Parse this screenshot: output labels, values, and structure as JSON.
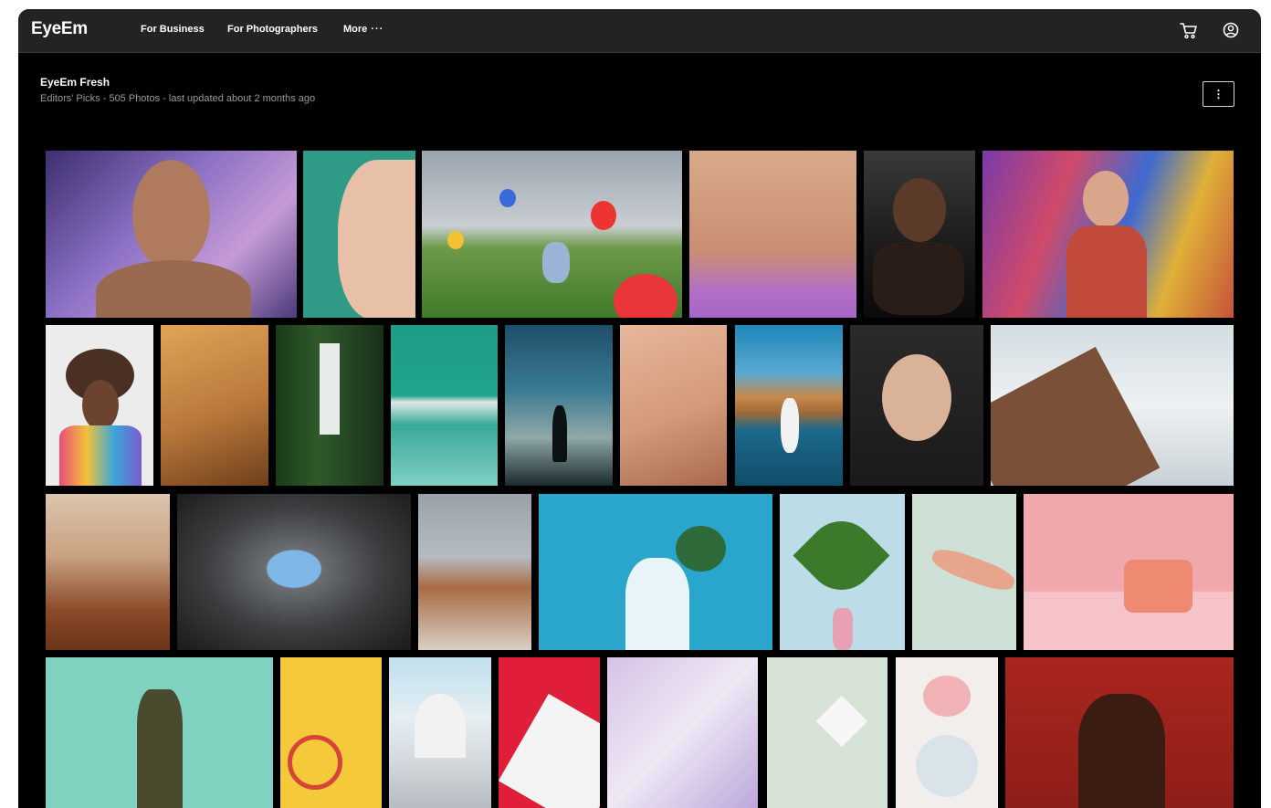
{
  "app": {
    "logo": "EyeEm"
  },
  "nav": {
    "items": [
      {
        "label": "For Business"
      },
      {
        "label": "For Photographers"
      },
      {
        "label": "More"
      }
    ],
    "more_suffix": "···"
  },
  "header_icons": [
    "cart-icon",
    "user-account-icon"
  ],
  "collection": {
    "title": "EyeEm Fresh",
    "subtitle": "Editors' Picks - 505 Photos - last updated about 2 months ago",
    "menu_glyph": "⋮"
  },
  "colors": {
    "topbar": "#232323",
    "page": "#000000",
    "text": "#ffffff",
    "muted": "#9a9a9a"
  }
}
